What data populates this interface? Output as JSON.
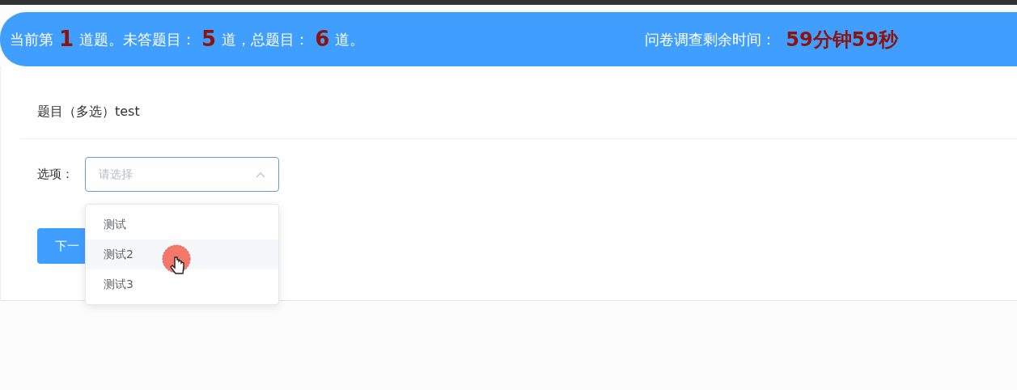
{
  "header": {
    "progress": [
      {
        "kind": "label",
        "text": "当前第"
      },
      {
        "kind": "count",
        "text": "1"
      },
      {
        "kind": "label",
        "text": "道题。未答题目："
      },
      {
        "kind": "count",
        "text": "5"
      },
      {
        "kind": "label",
        "text": "道，总题目："
      },
      {
        "kind": "count",
        "text": "6"
      },
      {
        "kind": "label",
        "text": "道。"
      }
    ],
    "timer_label": "问卷调查剩余时间：",
    "timer_value": "59分钟59秒"
  },
  "question": {
    "title": "题目（多选）test",
    "field_label": "选项：",
    "select": {
      "placeholder": "请选择",
      "expanded": true
    },
    "options": [
      {
        "label": "测试",
        "hovered": false
      },
      {
        "label": "测试2",
        "hovered": true
      },
      {
        "label": "测试3",
        "hovered": false
      }
    ],
    "next_button": "下一"
  }
}
